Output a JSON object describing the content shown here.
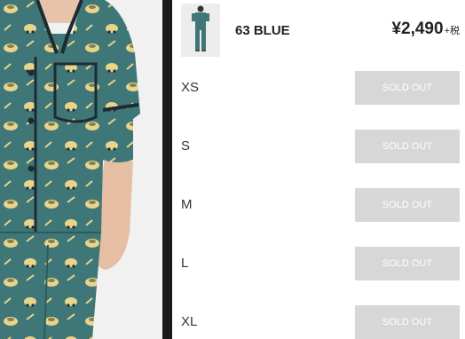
{
  "product": {
    "color_name": "63 BLUE",
    "price": "¥2,490",
    "tax_note": "+税"
  },
  "sizes": [
    {
      "label": "XS",
      "status": "SOLD OUT"
    },
    {
      "label": "S",
      "status": "SOLD OUT"
    },
    {
      "label": "M",
      "status": "SOLD OUT"
    },
    {
      "label": "L",
      "status": "SOLD OUT"
    },
    {
      "label": "XL",
      "status": "SOLD OUT"
    }
  ],
  "colors": {
    "fabric": "#3f7778",
    "fabric_dark": "#2d5b5c",
    "piping": "#1d2b33",
    "pattern": "#e8d48a",
    "soldout_bg": "#d7d7d7"
  }
}
